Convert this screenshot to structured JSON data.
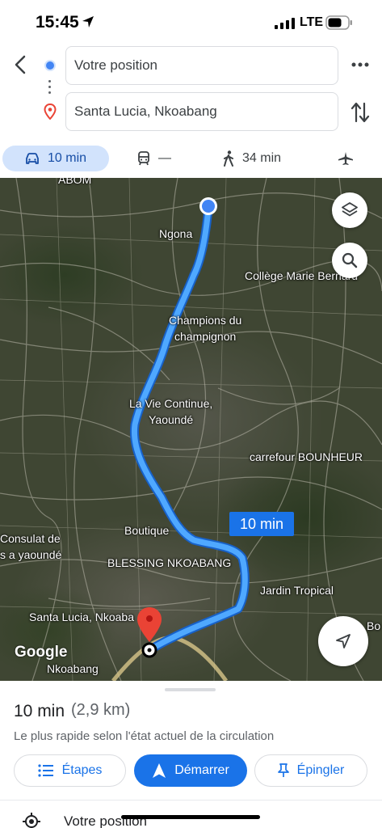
{
  "status_bar": {
    "time": "15:45",
    "network": "LTE"
  },
  "search": {
    "origin": "Votre position",
    "destination": "Santa Lucia, Nkoabang"
  },
  "modes": [
    {
      "name": "car-icon",
      "label": "10 min",
      "selected": true
    },
    {
      "name": "transit-icon",
      "label": "—"
    },
    {
      "name": "walk-icon",
      "label": "34 min"
    },
    {
      "name": "flight-icon",
      "label": ""
    }
  ],
  "map": {
    "labels": {
      "abom": "ABOM",
      "ngona": "Ngona",
      "college": "Collège Marie Bernard",
      "champions": "Champions du\nchampignon",
      "la_vie": "La Vie Continue,\nYaoundé",
      "carrefour": "carrefour BOUNHEUR",
      "boutique": "Boutique",
      "consulat": "Consulat de\ns a yaoundé",
      "blessing": "BLESSING NKOABANG",
      "jardin": "Jardin Tropical",
      "santa_lucia": "Santa Lucia, Nkoaba",
      "nkoabang": "Nkoabang",
      "bo": "Bo"
    },
    "route_time": "10 min",
    "watermark": "Google",
    "route_color": "#4fa8ff"
  },
  "sheet": {
    "duration": "10 min",
    "distance": "(2,9 km)",
    "description": "Le plus rapide selon l'état actuel de la circulation",
    "buttons": {
      "steps": "Étapes",
      "start": "Démarrer",
      "pin": "Épingler"
    },
    "first_step": "Votre position"
  },
  "colors": {
    "accent": "#1a73e8",
    "selected_mode_bg": "#d2e3fc",
    "destination_pin": "#ea4335"
  }
}
